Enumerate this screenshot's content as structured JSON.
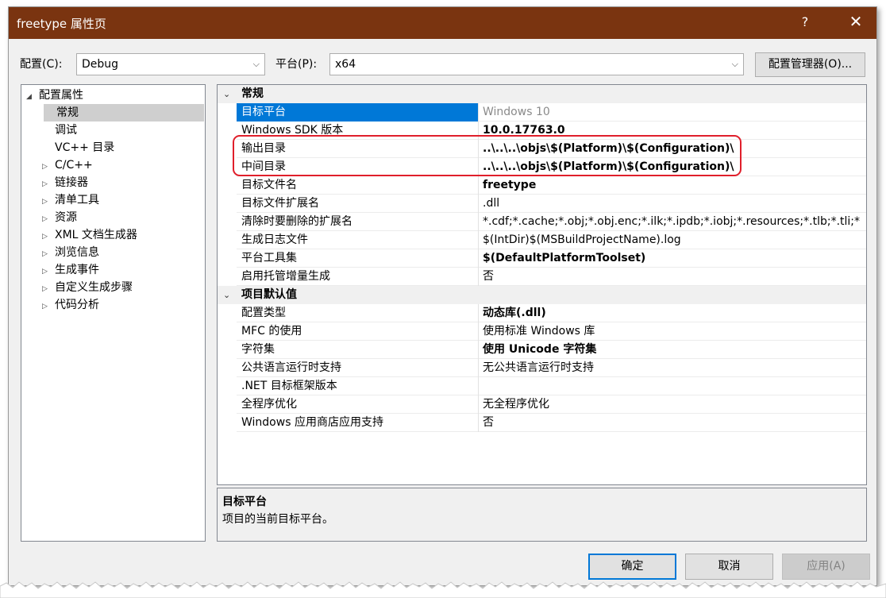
{
  "window": {
    "title": "freetype 属性页",
    "help_label": "?",
    "close_label": "✕"
  },
  "config": {
    "config_label": "配置(C):",
    "config_value": "Debug",
    "platform_label": "平台(P):",
    "platform_value": "x64",
    "manager_button": "配置管理器(O)..."
  },
  "tree": {
    "root": "配置属性",
    "items": [
      {
        "label": "常规",
        "expandable": false,
        "selected": true
      },
      {
        "label": "调试",
        "expandable": false,
        "selected": false
      },
      {
        "label": "VC++ 目录",
        "expandable": false,
        "selected": false
      },
      {
        "label": "C/C++",
        "expandable": true,
        "selected": false
      },
      {
        "label": "链接器",
        "expandable": true,
        "selected": false
      },
      {
        "label": "清单工具",
        "expandable": true,
        "selected": false
      },
      {
        "label": "资源",
        "expandable": true,
        "selected": false
      },
      {
        "label": "XML 文档生成器",
        "expandable": true,
        "selected": false
      },
      {
        "label": "浏览信息",
        "expandable": true,
        "selected": false
      },
      {
        "label": "生成事件",
        "expandable": true,
        "selected": false
      },
      {
        "label": "自定义生成步骤",
        "expandable": true,
        "selected": false
      },
      {
        "label": "代码分析",
        "expandable": true,
        "selected": false
      }
    ]
  },
  "grid": {
    "categories": [
      {
        "label": "常规",
        "props": [
          {
            "name": "目标平台",
            "value": "Windows 10",
            "style": "gray",
            "selected": true
          },
          {
            "name": "Windows SDK 版本",
            "value": "10.0.17763.0",
            "style": "bold"
          },
          {
            "name": "输出目录",
            "value": "..\\..\\..\\objs\\$(Platform)\\$(Configuration)\\",
            "style": "bold"
          },
          {
            "name": "中间目录",
            "value": "..\\..\\..\\objs\\$(Platform)\\$(Configuration)\\",
            "style": "bold"
          },
          {
            "name": "目标文件名",
            "value": "freetype",
            "style": "bold"
          },
          {
            "name": "目标文件扩展名",
            "value": ".dll",
            "style": "normal"
          },
          {
            "name": "清除时要删除的扩展名",
            "value": "*.cdf;*.cache;*.obj;*.obj.enc;*.ilk;*.ipdb;*.iobj;*.resources;*.tlb;*.tli;*",
            "style": "normal"
          },
          {
            "name": "生成日志文件",
            "value": "$(IntDir)$(MSBuildProjectName).log",
            "style": "normal"
          },
          {
            "name": "平台工具集",
            "value": "$(DefaultPlatformToolset)",
            "style": "bold"
          },
          {
            "name": "启用托管增量生成",
            "value": "否",
            "style": "normal"
          }
        ]
      },
      {
        "label": "项目默认值",
        "props": [
          {
            "name": "配置类型",
            "value": "动态库(.dll)",
            "style": "bold"
          },
          {
            "name": "MFC 的使用",
            "value": "使用标准 Windows 库",
            "style": "normal"
          },
          {
            "name": "字符集",
            "value": "使用 Unicode 字符集",
            "style": "bold"
          },
          {
            "name": "公共语言运行时支持",
            "value": "无公共语言运行时支持",
            "style": "normal"
          },
          {
            "name": ".NET 目标框架版本",
            "value": "",
            "style": "normal"
          },
          {
            "name": "全程序优化",
            "value": "无全程序优化",
            "style": "normal"
          },
          {
            "name": "Windows 应用商店应用支持",
            "value": "否",
            "style": "normal"
          }
        ]
      }
    ]
  },
  "description": {
    "title": "目标平台",
    "text": "项目的当前目标平台。"
  },
  "buttons": {
    "ok": "确定",
    "cancel": "取消",
    "apply": "应用(A)"
  },
  "colors": {
    "titlebar": "#7a3410",
    "selection": "#0078d7",
    "highlight_box": "#e01f2b"
  }
}
